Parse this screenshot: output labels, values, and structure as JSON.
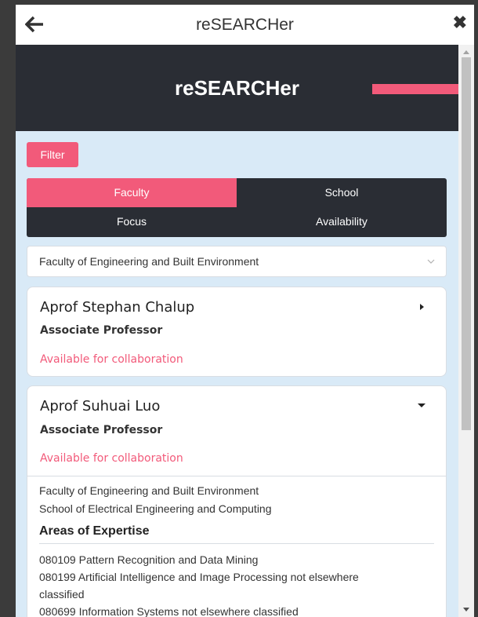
{
  "titlebar": {
    "title": "reSEARCHer",
    "back_icon": "arrow-left-icon",
    "close_icon": "close-icon",
    "close_glyph": "✖"
  },
  "banner": {
    "title": "reSEARCHer",
    "accent_color": "#f25a7a",
    "background_color": "#2a2d34"
  },
  "filter": {
    "label": "Filter"
  },
  "tabs": [
    {
      "label": "Faculty",
      "active": true
    },
    {
      "label": "School",
      "active": false
    },
    {
      "label": "Focus",
      "active": false
    },
    {
      "label": "Availability",
      "active": false
    }
  ],
  "faculty_select": {
    "value": "Faculty of Engineering and Built Environment"
  },
  "results": [
    {
      "name": "Aprof Stephan Chalup",
      "role": "Associate Professor",
      "availability": "Available for collaboration",
      "expanded": false
    },
    {
      "name": "Aprof Suhuai Luo",
      "role": "Associate Professor",
      "availability": "Available for collaboration",
      "expanded": true,
      "faculty": "Faculty of Engineering and Built Environment",
      "school": "School of Electrical Engineering and Computing",
      "expertise_heading": "Areas of Expertise",
      "expertise": [
        "080109 Pattern Recognition and Data Mining",
        "080199 Artificial Intelligence and Image Processing not elsewhere",
        "classified",
        "080699 Information Systems not elsewhere classified"
      ]
    }
  ],
  "colors": {
    "accent": "#f25a7a",
    "content_bg": "#d9eaf7",
    "dark": "#2a2d34"
  }
}
